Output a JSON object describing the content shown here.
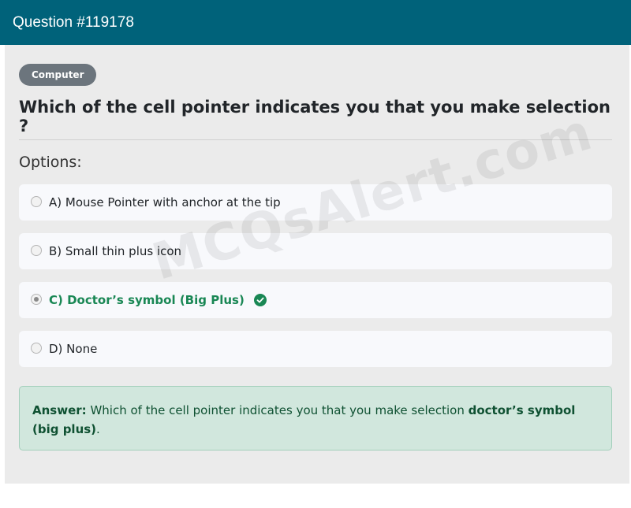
{
  "header": {
    "title": "Question #119178"
  },
  "category": "Computer",
  "question": "Which of the cell pointer indicates you that you make selection ?",
  "options_label": "Options:",
  "options": [
    {
      "label": "A) Mouse Pointer with anchor at the tip",
      "selected": false,
      "correct": false
    },
    {
      "label": "B) Small thin plus icon",
      "selected": false,
      "correct": false
    },
    {
      "label": "C) Doctor’s symbol (Big Plus)",
      "selected": true,
      "correct": true
    },
    {
      "label": "D) None",
      "selected": false,
      "correct": false
    }
  ],
  "answer": {
    "prefix": "Answer:",
    "text": "Which of the cell pointer indicates you that you make selection",
    "bold_text": "doctor’s symbol (big plus)",
    "suffix": "."
  },
  "watermark": "MCQsAlert.com",
  "icons": {
    "correct": "check-circle-icon"
  },
  "colors": {
    "header": "#00627a",
    "correct": "#198754",
    "answer_bg": "#d1e7dd"
  }
}
